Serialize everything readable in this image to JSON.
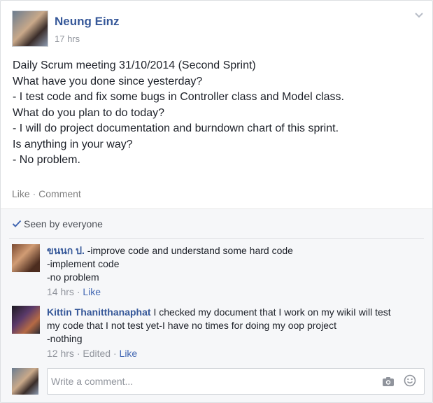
{
  "post": {
    "author": "Neung Einz",
    "time": "17 hrs",
    "lines": [
      "Daily Scrum meeting 31/10/2014 (Second Sprint)",
      "What have you done since yesterday?",
      "- I test code and fix some bugs in Controller class and Model class.",
      "What do you plan to do today?",
      "- I will do project documentation and burndown chart of this sprint.",
      "Is anything in your way?",
      "- No problem."
    ],
    "actions": {
      "like": "Like",
      "separator": "·",
      "comment": "Comment"
    }
  },
  "seen": {
    "label": "Seen by everyone"
  },
  "comments": [
    {
      "name": "ขนนก ป.",
      "lines": [
        "-improve code and understand some hard code",
        "-implement code",
        "-no problem"
      ],
      "time": "14 hrs",
      "separator": "·",
      "like": "Like"
    },
    {
      "name": "Kittin Thanitthanaphat",
      "lines": [
        "I checked my document that I work on my wikiI will test",
        "my code that I not test yet-I have no times for doing my oop project",
        "-nothing"
      ],
      "time": "12 hrs",
      "separator": "·",
      "edited": "Edited",
      "separator2": "·",
      "like": "Like"
    }
  ],
  "composer": {
    "placeholder": "Write a comment..."
  },
  "colors": {
    "link": "#365899",
    "muted": "#90949c",
    "like": "#4267b2"
  }
}
